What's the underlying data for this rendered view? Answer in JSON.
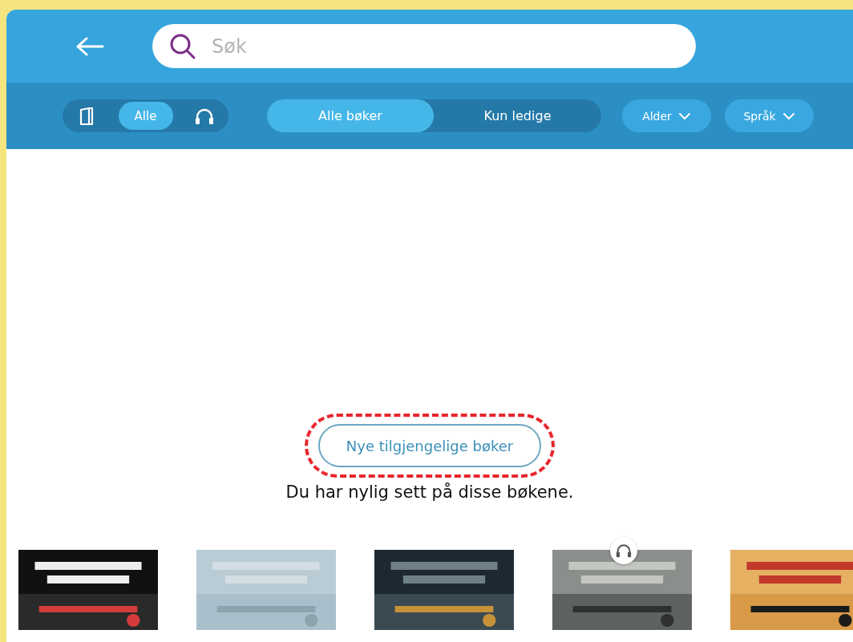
{
  "search": {
    "placeholder": "Søk"
  },
  "format_filter": [
    {
      "kind": "book",
      "selected": false
    },
    {
      "kind": "text",
      "label": "Alle",
      "selected": true
    },
    {
      "kind": "headphones",
      "selected": false
    }
  ],
  "availability_filter": [
    {
      "label": "Alle bøker",
      "selected": true
    },
    {
      "label": "Kun ledige",
      "selected": false
    }
  ],
  "dropdowns": [
    {
      "label": "Alder"
    },
    {
      "label": "Språk"
    }
  ],
  "new_books_button": {
    "label": "Nye tilgjengelige bøker",
    "highlighted": true
  },
  "recent_heading": "Du har nylig sett på disse bøkene.",
  "books": [
    {
      "kind": "picture",
      "audio": false
    },
    {
      "kind": "picture",
      "audio": false
    },
    {
      "kind": "picture",
      "audio": false
    },
    {
      "kind": "picture",
      "audio": true
    },
    {
      "kind": "picture",
      "audio": false
    }
  ]
}
